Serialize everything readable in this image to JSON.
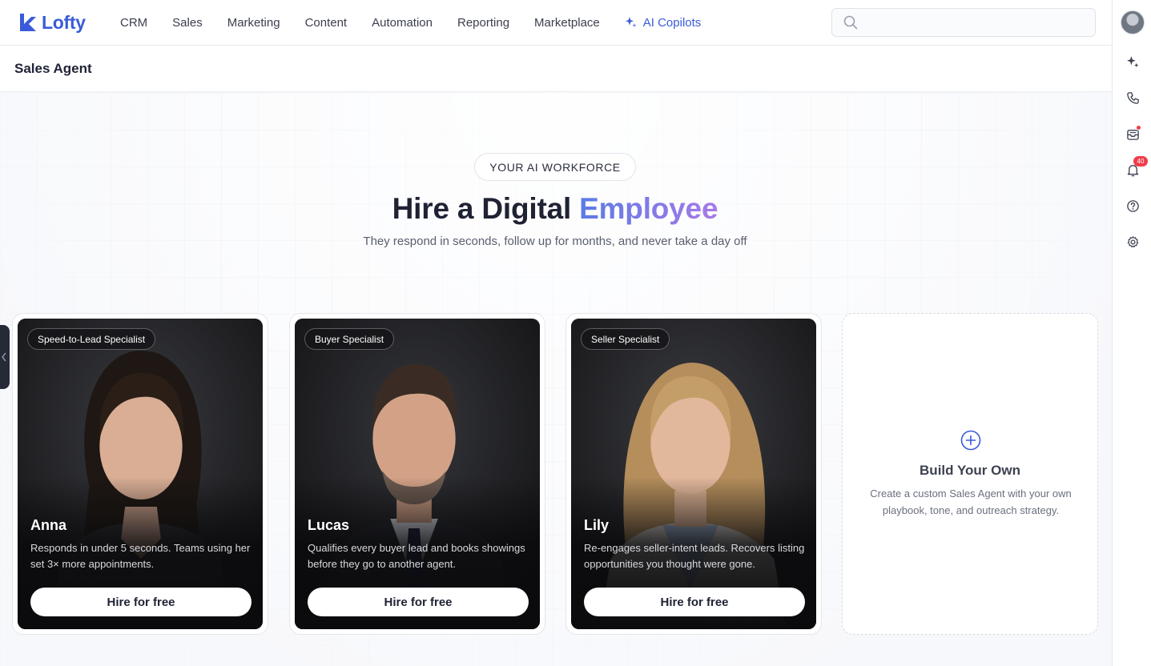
{
  "brand": {
    "name": "Lofty",
    "color": "#3a5bd9"
  },
  "nav": {
    "items": [
      "CRM",
      "Sales",
      "Marketing",
      "Content",
      "Automation",
      "Reporting",
      "Marketplace"
    ],
    "ai_item": "AI Copilots"
  },
  "search": {
    "placeholder": ""
  },
  "rail": {
    "notification_count": "40"
  },
  "page": {
    "title": "Sales Agent"
  },
  "hero": {
    "eyebrow": "YOUR AI WORKFORCE",
    "headline_main": "Hire a Digital",
    "headline_accent": "Employee",
    "subline": "They respond in seconds, follow up for months, and never take a day off"
  },
  "agents": [
    {
      "tag": "Speed-to-Lead Specialist",
      "name": "Anna",
      "description": "Responds in under 5 seconds. Teams using her set 3× more appointments.",
      "button": "Hire for free"
    },
    {
      "tag": "Buyer Specialist",
      "name": "Lucas",
      "description": "Qualifies every buyer lead and books showings before they go to another agent.",
      "button": "Hire for free"
    },
    {
      "tag": "Seller Specialist",
      "name": "Lily",
      "description": "Re-engages seller-intent leads. Recovers listing opportunities you thought were gone.",
      "button": "Hire for free"
    }
  ],
  "build": {
    "title": "Build Your Own",
    "description": "Create a custom Sales Agent with your own playbook, tone, and outreach strategy."
  },
  "icons": {
    "logo": "lofty-logo-icon",
    "ai": "sparkle-icon",
    "search": "search-icon",
    "phone": "phone-icon",
    "inbox": "inbox-icon",
    "bell": "bell-icon",
    "help": "help-icon",
    "settings": "gear-icon",
    "add": "plus-circle-icon"
  }
}
